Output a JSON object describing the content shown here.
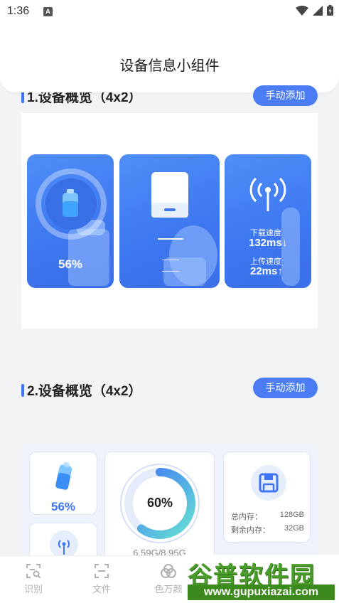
{
  "status_bar": {
    "time": "1:36",
    "badge": "A"
  },
  "header": {
    "title": "设备信息小组件"
  },
  "section1": {
    "title": "1.设备概览（4x2）",
    "button": "手动添加"
  },
  "battery_card": {
    "percent": "56%"
  },
  "network_card": {
    "download_label": "下载速度",
    "download_value": "132ms↓",
    "upload_label": "上传速度",
    "upload_value": "22ms↑"
  },
  "section2": {
    "title": "2.设备概览（4x2）",
    "button": "手动添加"
  },
  "widget2": {
    "battery_percent": "56%",
    "memory_percent": "60%",
    "memory_used": "6.59G/8.95G",
    "memory_ring_fraction": 0.6,
    "storage_total_label": "总内存：",
    "storage_total_value": "128GB",
    "storage_free_label": "剩余内存：",
    "storage_free_value": "32GB"
  },
  "nav": {
    "items": [
      "识别",
      "文件",
      "色万颜"
    ]
  },
  "watermark": {
    "title": "谷普软件园",
    "url": "www.gupuxiazai.com"
  },
  "colors": {
    "accent": "#4b7cf3",
    "card_blue": "#3d77f0",
    "watermark_green": "#3c8a1e"
  }
}
